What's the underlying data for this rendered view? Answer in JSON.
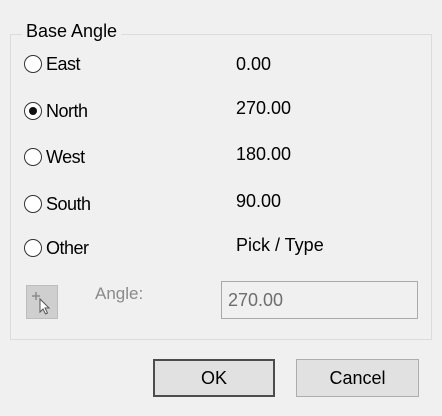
{
  "group": {
    "title": "Base Angle"
  },
  "options": [
    {
      "label": "East",
      "value": "0.00",
      "checked": false
    },
    {
      "label": "North",
      "value": "270.00",
      "checked": true
    },
    {
      "label": "West",
      "value": "180.00",
      "checked": false
    },
    {
      "label": "South",
      "value": "90.00",
      "checked": false
    },
    {
      "label": "Other",
      "value": "Pick / Type",
      "checked": false
    }
  ],
  "angle": {
    "label": "Angle:",
    "value": "270.00"
  },
  "pick_button": {
    "icon": "pick-point-cursor-icon"
  },
  "buttons": {
    "ok": "OK",
    "cancel": "Cancel"
  }
}
